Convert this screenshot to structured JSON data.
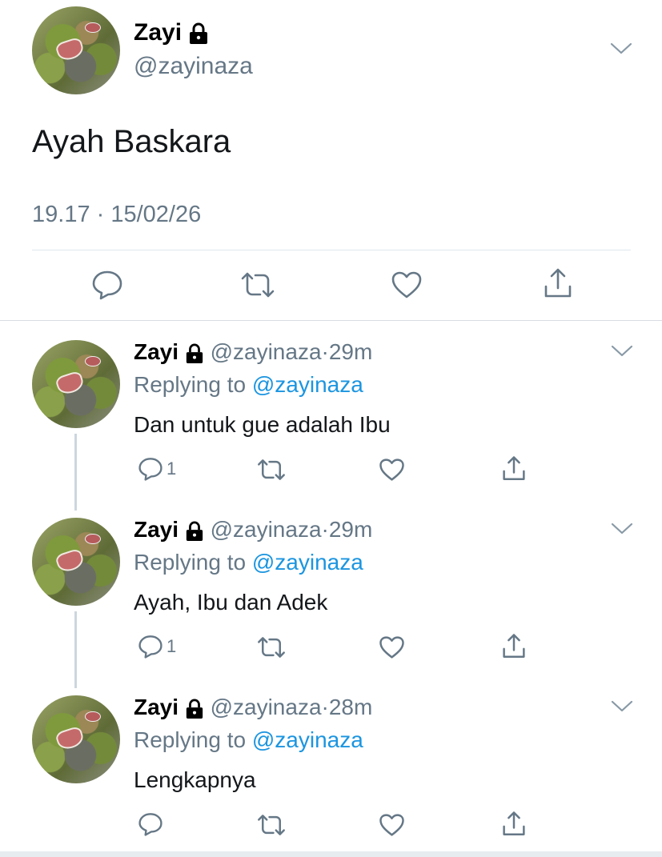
{
  "main_tweet": {
    "name": "Zayi",
    "handle": "@zayinaza",
    "text": "Ayah Baskara",
    "timestamp": "19.17 · 15/02/26"
  },
  "replies": [
    {
      "name": "Zayi",
      "handle": "@zayinaza",
      "time": "29m",
      "replying_label": "Replying to",
      "replying_to": "@zayinaza",
      "text": "Dan untuk gue adalah Ibu",
      "reply_count": "1"
    },
    {
      "name": "Zayi",
      "handle": "@zayinaza",
      "time": "29m",
      "replying_label": "Replying to",
      "replying_to": "@zayinaza",
      "text": "Ayah, Ibu dan Adek",
      "reply_count": "1"
    },
    {
      "name": "Zayi",
      "handle": "@zayinaza",
      "time": "28m",
      "replying_label": "Replying to",
      "replying_to": "@zayinaza",
      "text": "Lengkapnya",
      "reply_count": ""
    }
  ],
  "icons": {
    "lock": "lock-icon",
    "chevron": "chevron-down-icon",
    "reply": "reply-icon",
    "retweet": "retweet-icon",
    "like": "heart-icon",
    "share": "share-icon"
  },
  "colors": {
    "secondary_text": "#657786",
    "mention": "#1b95e0",
    "thread_line": "#ccd6dd"
  }
}
